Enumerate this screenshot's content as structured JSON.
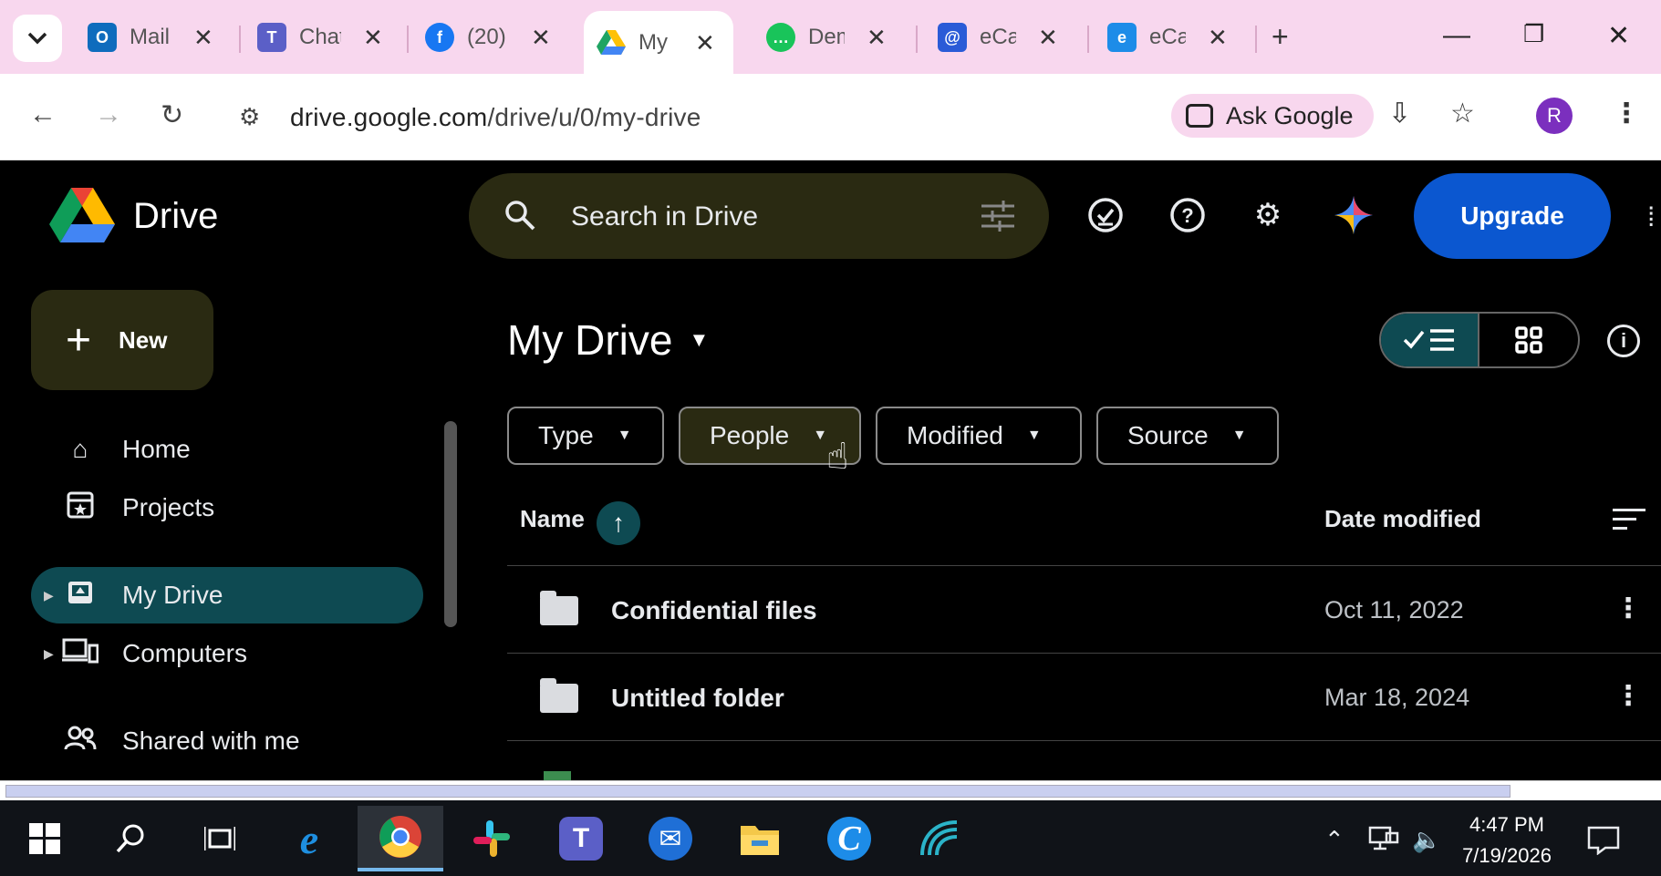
{
  "browser": {
    "tabs": [
      {
        "title": "Mail",
        "icon": "outlook-icon",
        "color": "#0f6cbd"
      },
      {
        "title": "Chat",
        "icon": "teams-icon",
        "color": "#5b5fc7"
      },
      {
        "title": "(20)",
        "icon": "facebook-icon",
        "color": "#1877f2"
      },
      {
        "title": "My Drive",
        "icon": "drive-icon",
        "color": "#1fa463",
        "active": true
      },
      {
        "title": "Dem",
        "icon": "chat-bubble-icon",
        "color": "#19c45a"
      },
      {
        "title": "eCa",
        "icon": "messenger-icon",
        "color": "#2a5bd7"
      },
      {
        "title": "eCa",
        "icon": "e-icon",
        "color": "#1d8ce8"
      }
    ],
    "url_host": "drive.google.com",
    "url_path": "/drive/u/0/my-drive",
    "ask_google": "Ask Google",
    "profile_initial": "R"
  },
  "drive": {
    "app_name": "Drive",
    "search_placeholder": "Search in Drive",
    "upgrade": "Upgrade",
    "new_button": "New",
    "nav": [
      {
        "label": "Home",
        "icon": "home-icon"
      },
      {
        "label": "Projects",
        "icon": "projects-icon"
      },
      {
        "label": "My Drive",
        "icon": "my-drive-icon",
        "active": true
      },
      {
        "label": "Computers",
        "icon": "computers-icon"
      },
      {
        "label": "Shared with me",
        "icon": "shared-icon"
      }
    ],
    "page_title": "My Drive",
    "filters": [
      "Type",
      "People",
      "Modified",
      "Source"
    ],
    "columns": {
      "name": "Name",
      "date": "Date modified"
    },
    "files": [
      {
        "name": "Confidential files",
        "date": "Oct 11, 2022",
        "type": "folder"
      },
      {
        "name": "Untitled folder",
        "date": "Mar 18, 2024",
        "type": "folder"
      }
    ]
  },
  "taskbar": {
    "time": "4:47 PM",
    "date": "7/19/2026"
  },
  "colors": {
    "accent_teal": "#0e4a52",
    "upgrade_blue": "#0b57d0",
    "tab_strip": "#f8d7ee"
  }
}
